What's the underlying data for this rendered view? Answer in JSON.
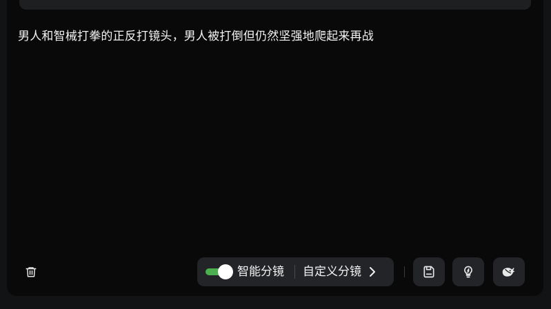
{
  "prompt": {
    "text": "男人和智械打拳的正反打镜头，男人被打倒但仍然坚强地爬起来再战"
  },
  "toolbar": {
    "smart_storyboard": {
      "label": "智能分镜",
      "enabled": true
    },
    "custom_storyboard": {
      "label": "自定义分镜"
    },
    "icons": {
      "delete": "trash-icon",
      "save": "save-icon",
      "inspiration": "lightbulb-icon",
      "model": "whale-icon"
    }
  },
  "colors": {
    "background": "#09090a",
    "button_bg": "#232427",
    "toggle_on": "#4caf50",
    "text": "#f2f2f2"
  }
}
